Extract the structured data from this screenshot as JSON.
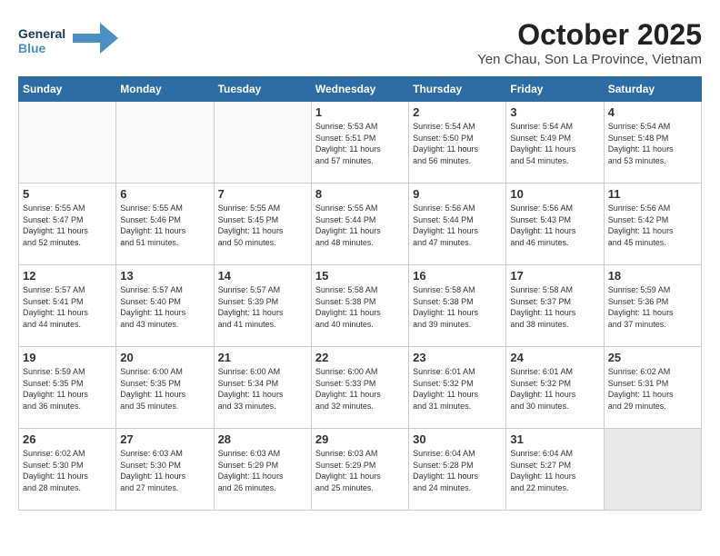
{
  "header": {
    "logo_line1": "General",
    "logo_line2": "Blue",
    "month": "October 2025",
    "location": "Yen Chau, Son La Province, Vietnam"
  },
  "weekdays": [
    "Sunday",
    "Monday",
    "Tuesday",
    "Wednesday",
    "Thursday",
    "Friday",
    "Saturday"
  ],
  "weeks": [
    [
      {
        "day": "",
        "empty": true
      },
      {
        "day": "",
        "empty": true
      },
      {
        "day": "",
        "empty": true
      },
      {
        "day": "1",
        "lines": [
          "Sunrise: 5:53 AM",
          "Sunset: 5:51 PM",
          "Daylight: 11 hours",
          "and 57 minutes."
        ]
      },
      {
        "day": "2",
        "lines": [
          "Sunrise: 5:54 AM",
          "Sunset: 5:50 PM",
          "Daylight: 11 hours",
          "and 56 minutes."
        ]
      },
      {
        "day": "3",
        "lines": [
          "Sunrise: 5:54 AM",
          "Sunset: 5:49 PM",
          "Daylight: 11 hours",
          "and 54 minutes."
        ]
      },
      {
        "day": "4",
        "lines": [
          "Sunrise: 5:54 AM",
          "Sunset: 5:48 PM",
          "Daylight: 11 hours",
          "and 53 minutes."
        ]
      }
    ],
    [
      {
        "day": "5",
        "lines": [
          "Sunrise: 5:55 AM",
          "Sunset: 5:47 PM",
          "Daylight: 11 hours",
          "and 52 minutes."
        ]
      },
      {
        "day": "6",
        "lines": [
          "Sunrise: 5:55 AM",
          "Sunset: 5:46 PM",
          "Daylight: 11 hours",
          "and 51 minutes."
        ]
      },
      {
        "day": "7",
        "lines": [
          "Sunrise: 5:55 AM",
          "Sunset: 5:45 PM",
          "Daylight: 11 hours",
          "and 50 minutes."
        ]
      },
      {
        "day": "8",
        "lines": [
          "Sunrise: 5:55 AM",
          "Sunset: 5:44 PM",
          "Daylight: 11 hours",
          "and 48 minutes."
        ]
      },
      {
        "day": "9",
        "lines": [
          "Sunrise: 5:56 AM",
          "Sunset: 5:44 PM",
          "Daylight: 11 hours",
          "and 47 minutes."
        ]
      },
      {
        "day": "10",
        "lines": [
          "Sunrise: 5:56 AM",
          "Sunset: 5:43 PM",
          "Daylight: 11 hours",
          "and 46 minutes."
        ]
      },
      {
        "day": "11",
        "lines": [
          "Sunrise: 5:56 AM",
          "Sunset: 5:42 PM",
          "Daylight: 11 hours",
          "and 45 minutes."
        ]
      }
    ],
    [
      {
        "day": "12",
        "lines": [
          "Sunrise: 5:57 AM",
          "Sunset: 5:41 PM",
          "Daylight: 11 hours",
          "and 44 minutes."
        ]
      },
      {
        "day": "13",
        "lines": [
          "Sunrise: 5:57 AM",
          "Sunset: 5:40 PM",
          "Daylight: 11 hours",
          "and 43 minutes."
        ]
      },
      {
        "day": "14",
        "lines": [
          "Sunrise: 5:57 AM",
          "Sunset: 5:39 PM",
          "Daylight: 11 hours",
          "and 41 minutes."
        ]
      },
      {
        "day": "15",
        "lines": [
          "Sunrise: 5:58 AM",
          "Sunset: 5:38 PM",
          "Daylight: 11 hours",
          "and 40 minutes."
        ]
      },
      {
        "day": "16",
        "lines": [
          "Sunrise: 5:58 AM",
          "Sunset: 5:38 PM",
          "Daylight: 11 hours",
          "and 39 minutes."
        ]
      },
      {
        "day": "17",
        "lines": [
          "Sunrise: 5:58 AM",
          "Sunset: 5:37 PM",
          "Daylight: 11 hours",
          "and 38 minutes."
        ]
      },
      {
        "day": "18",
        "lines": [
          "Sunrise: 5:59 AM",
          "Sunset: 5:36 PM",
          "Daylight: 11 hours",
          "and 37 minutes."
        ]
      }
    ],
    [
      {
        "day": "19",
        "lines": [
          "Sunrise: 5:59 AM",
          "Sunset: 5:35 PM",
          "Daylight: 11 hours",
          "and 36 minutes."
        ]
      },
      {
        "day": "20",
        "lines": [
          "Sunrise: 6:00 AM",
          "Sunset: 5:35 PM",
          "Daylight: 11 hours",
          "and 35 minutes."
        ]
      },
      {
        "day": "21",
        "lines": [
          "Sunrise: 6:00 AM",
          "Sunset: 5:34 PM",
          "Daylight: 11 hours",
          "and 33 minutes."
        ]
      },
      {
        "day": "22",
        "lines": [
          "Sunrise: 6:00 AM",
          "Sunset: 5:33 PM",
          "Daylight: 11 hours",
          "and 32 minutes."
        ]
      },
      {
        "day": "23",
        "lines": [
          "Sunrise: 6:01 AM",
          "Sunset: 5:32 PM",
          "Daylight: 11 hours",
          "and 31 minutes."
        ]
      },
      {
        "day": "24",
        "lines": [
          "Sunrise: 6:01 AM",
          "Sunset: 5:32 PM",
          "Daylight: 11 hours",
          "and 30 minutes."
        ]
      },
      {
        "day": "25",
        "lines": [
          "Sunrise: 6:02 AM",
          "Sunset: 5:31 PM",
          "Daylight: 11 hours",
          "and 29 minutes."
        ]
      }
    ],
    [
      {
        "day": "26",
        "lines": [
          "Sunrise: 6:02 AM",
          "Sunset: 5:30 PM",
          "Daylight: 11 hours",
          "and 28 minutes."
        ]
      },
      {
        "day": "27",
        "lines": [
          "Sunrise: 6:03 AM",
          "Sunset: 5:30 PM",
          "Daylight: 11 hours",
          "and 27 minutes."
        ]
      },
      {
        "day": "28",
        "lines": [
          "Sunrise: 6:03 AM",
          "Sunset: 5:29 PM",
          "Daylight: 11 hours",
          "and 26 minutes."
        ]
      },
      {
        "day": "29",
        "lines": [
          "Sunrise: 6:03 AM",
          "Sunset: 5:29 PM",
          "Daylight: 11 hours",
          "and 25 minutes."
        ]
      },
      {
        "day": "30",
        "lines": [
          "Sunrise: 6:04 AM",
          "Sunset: 5:28 PM",
          "Daylight: 11 hours",
          "and 24 minutes."
        ]
      },
      {
        "day": "31",
        "lines": [
          "Sunrise: 6:04 AM",
          "Sunset: 5:27 PM",
          "Daylight: 11 hours",
          "and 22 minutes."
        ]
      },
      {
        "day": "",
        "empty": true,
        "shaded": true
      }
    ]
  ]
}
